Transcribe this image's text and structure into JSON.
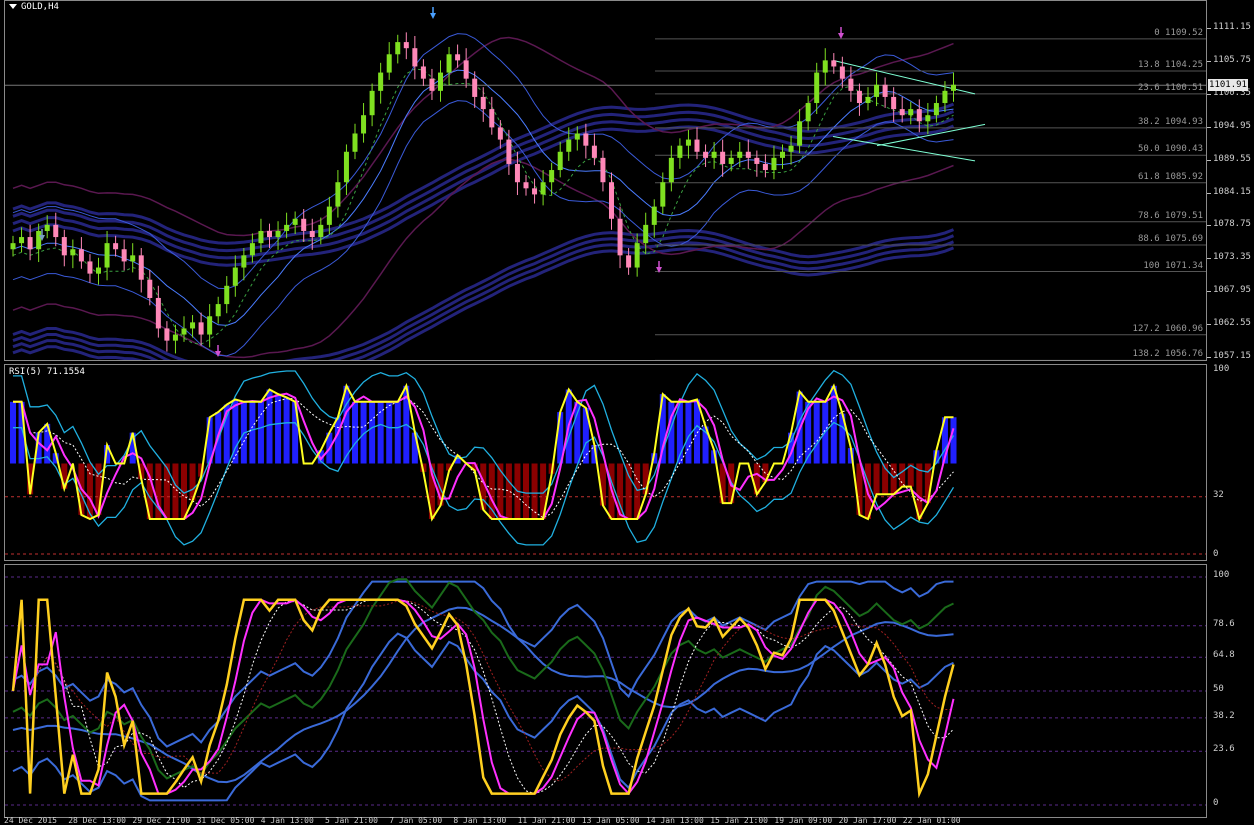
{
  "main": {
    "symbol": "GOLD,H4",
    "current_price": "1101.91",
    "price_labels": [
      "1111.15",
      "1105.75",
      "1100.35",
      "1094.95",
      "1089.55",
      "1084.15",
      "1078.75",
      "1073.35",
      "1067.95",
      "1062.55",
      "1057.15"
    ],
    "fibo_levels": [
      {
        "label": "0 1109.52",
        "price": 1109.52
      },
      {
        "label": "13.8 1104.25",
        "price": 1104.25
      },
      {
        "label": "23.6 1100.51",
        "price": 1100.51
      },
      {
        "label": "38.2 1094.93",
        "price": 1094.93
      },
      {
        "label": "50.0 1090.43",
        "price": 1090.43
      },
      {
        "label": "61.8 1085.92",
        "price": 1085.92
      },
      {
        "label": "78.6 1079.51",
        "price": 1079.51
      },
      {
        "label": "88.6 1075.69",
        "price": 1075.69
      },
      {
        "label": "100 1071.34",
        "price": 1071.34
      },
      {
        "label": "127.2 1060.96",
        "price": 1060.96
      },
      {
        "label": "138.2 1056.76",
        "price": 1056.76
      }
    ],
    "colors": {
      "bull": "#7fe020",
      "bear": "#ff88b8",
      "env": "#23237a",
      "bb": "#3a5ad8",
      "purple": "#5a1850"
    }
  },
  "rsi": {
    "title": "RSI(5) 71.1554",
    "levels": [
      "100",
      "32",
      "0"
    ]
  },
  "stoch": {
    "levels": [
      "100",
      "78.6",
      "64.8",
      "50",
      "38.2",
      "23.6",
      "0"
    ]
  },
  "time_labels": [
    "24 Dec 2015",
    "28 Dec 13:00",
    "29 Dec 21:00",
    "31 Dec 05:00",
    "4 Jan 13:00",
    "5 Jan 21:00",
    "7 Jan 05:00",
    "8 Jan 13:00",
    "11 Jan 21:00",
    "13 Jan 05:00",
    "14 Jan 13:00",
    "15 Jan 21:00",
    "19 Jan 09:00",
    "20 Jan 17:00",
    "22 Jan 01:00"
  ],
  "chart_data": {
    "type": "candlestick",
    "title": "GOLD,H4",
    "ylim": [
      1057.15,
      1111.15
    ],
    "close_series": [
      1076,
      1077,
      1075,
      1078,
      1079,
      1077,
      1074,
      1075,
      1073,
      1071,
      1072,
      1076,
      1075,
      1073,
      1074,
      1070,
      1067,
      1062,
      1060,
      1061,
      1062,
      1063,
      1061,
      1064,
      1066,
      1069,
      1072,
      1074,
      1076,
      1078,
      1077,
      1078,
      1079,
      1080,
      1078,
      1077,
      1079,
      1082,
      1086,
      1091,
      1094,
      1097,
      1101,
      1104,
      1107,
      1109,
      1108,
      1105,
      1103,
      1101,
      1104,
      1107,
      1106,
      1103,
      1100,
      1098,
      1095,
      1093,
      1089,
      1086,
      1085,
      1084,
      1086,
      1088,
      1091,
      1093,
      1094,
      1092,
      1090,
      1086,
      1080,
      1074,
      1072,
      1076,
      1079,
      1082,
      1086,
      1090,
      1092,
      1093,
      1091,
      1090,
      1091,
      1089,
      1090,
      1091,
      1090,
      1089,
      1088,
      1090,
      1091,
      1092,
      1096,
      1099,
      1104,
      1106,
      1105,
      1103,
      1101,
      1099,
      1100,
      1102,
      1100,
      1098,
      1097,
      1098,
      1096,
      1097,
      1099,
      1101,
      1102
    ]
  }
}
